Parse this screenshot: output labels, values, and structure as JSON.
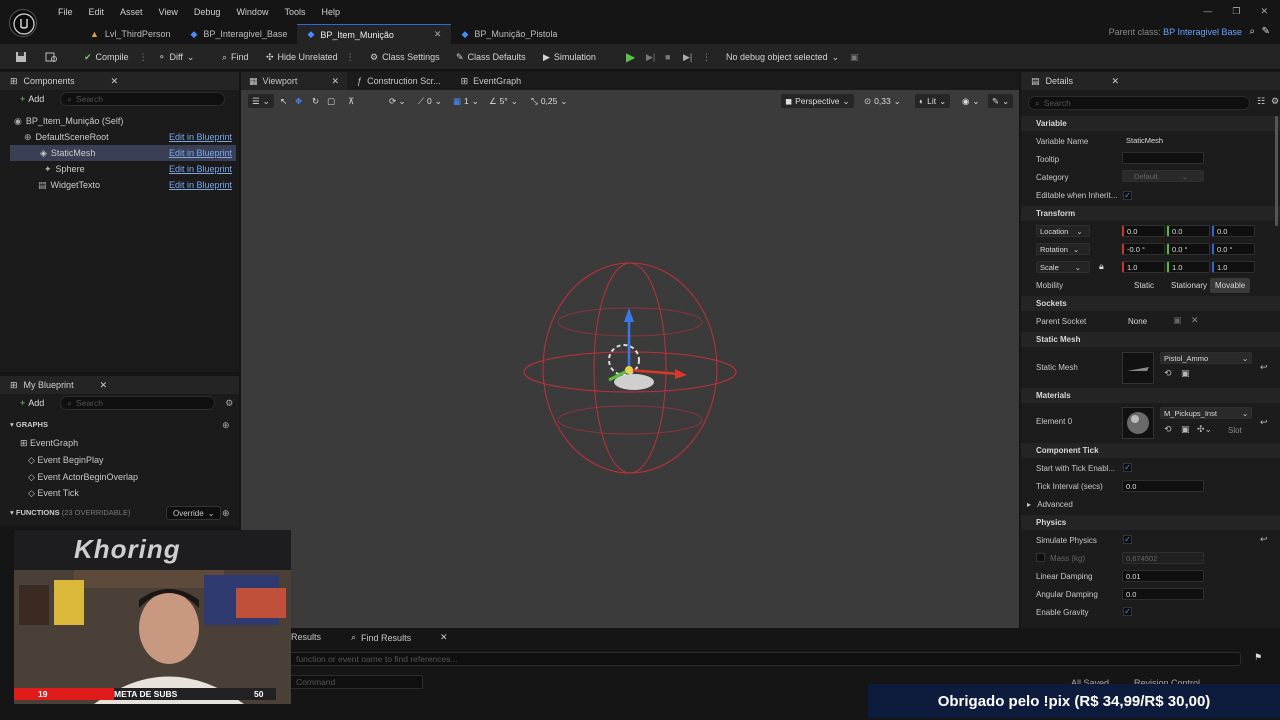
{
  "menu": [
    "File",
    "Edit",
    "Asset",
    "View",
    "Debug",
    "Window",
    "Tools",
    "Help"
  ],
  "tabs": [
    {
      "label": "Lvl_ThirdPerson"
    },
    {
      "label": "BP_Interagivel_Base"
    },
    {
      "label": "BP_Item_Munição"
    },
    {
      "label": "BP_Munição_Pistola"
    }
  ],
  "parent_class": {
    "label": "Parent class:",
    "value": "BP Interagivel Base"
  },
  "toolbar": {
    "compile": "Compile",
    "diff": "Diff",
    "find": "Find",
    "hide_unrelated": "Hide Unrelated",
    "class_settings": "Class Settings",
    "class_defaults": "Class Defaults",
    "simulation": "Simulation",
    "debug_object": "No debug object selected"
  },
  "components": {
    "title": "Components",
    "add": "Add",
    "search": "Search",
    "items": [
      {
        "label": "BP_Item_Munição (Self)",
        "link": ""
      },
      {
        "label": "DefaultSceneRoot",
        "link": "Edit in Blueprint"
      },
      {
        "label": "StaticMesh",
        "link": "Edit in Blueprint"
      },
      {
        "label": "Sphere",
        "link": "Edit in Blueprint"
      },
      {
        "label": "WidgetTexto",
        "link": "Edit in Blueprint"
      }
    ]
  },
  "viewport_tabs": {
    "viewport": "Viewport",
    "construction": "Construction Scr...",
    "eventgraph": "EventGraph"
  },
  "viewport_toolbar": {
    "rot_snap": "0",
    "scale_snap": "1",
    "angle": "5°",
    "scale": "0,25",
    "perspective": "Perspective",
    "speed": "0,33",
    "lit": "Lit"
  },
  "my_blueprint": {
    "title": "My Blueprint",
    "add": "Add",
    "search": "Search",
    "graphs": "GRAPHS",
    "graph_name": "EventGraph",
    "events": [
      "Event BeginPlay",
      "Event ActorBeginOverlap",
      "Event Tick"
    ],
    "functions": "FUNCTIONS",
    "overridable": "(23 OVERRIDABLE)",
    "override": "Override"
  },
  "details": {
    "title": "Details",
    "search": "Search",
    "variable": {
      "section": "Variable",
      "name_label": "Variable Name",
      "name": "StaticMesh",
      "tooltip_label": "Tooltip",
      "category_label": "Category",
      "category": "Default",
      "editable_label": "Editable when Inherit..."
    },
    "transform": {
      "section": "Transform",
      "location": "Location",
      "rotation": "Rotation",
      "scale": "Scale",
      "loc": [
        "0.0",
        "0.0",
        "0.0"
      ],
      "rot": [
        "-0.0 °",
        "0.0 °",
        "0.0 °"
      ],
      "scl": [
        "1.0",
        "1.0",
        "1.0"
      ],
      "mobility": "Mobility",
      "static": "Static",
      "stationary": "Stationary",
      "movable": "Movable"
    },
    "sockets": {
      "section": "Sockets",
      "parent_label": "Parent Socket",
      "parent": "None"
    },
    "static_mesh": {
      "section": "Static Mesh",
      "label": "Static Mesh",
      "value": "Pistol_Ammo"
    },
    "materials": {
      "section": "Materials",
      "label": "Element 0",
      "value": "M_Pickups_Inst",
      "slot": "Slot"
    },
    "tick": {
      "section": "Component Tick",
      "start_label": "Start with Tick Enabl...",
      "interval_label": "Tick Interval (secs)",
      "interval": "0.0",
      "advanced": "Advanced"
    },
    "physics": {
      "section": "Physics",
      "simulate": "Simulate Physics",
      "mass_label": "Mass (kg)",
      "mass": "0,674502",
      "linear_label": "Linear Damping",
      "linear": "0.01",
      "angular_label": "Angular Damping",
      "angular": "0.0",
      "gravity": "Enable Gravity"
    }
  },
  "bottom": {
    "results": "Results",
    "find_results": "Find Results",
    "find_placeholder": "function or event name to find references...",
    "command": "Command",
    "all_saved": "All Saved",
    "revision": "Revision Control"
  },
  "stream": {
    "sub_current": "19",
    "sub_label": "META DE SUBS",
    "sub_goal": "50",
    "sub_progress": 0.38,
    "donation": "Obrigado pelo !pix (R$ 34,99/R$ 30,00)",
    "banner": "Khoring"
  }
}
